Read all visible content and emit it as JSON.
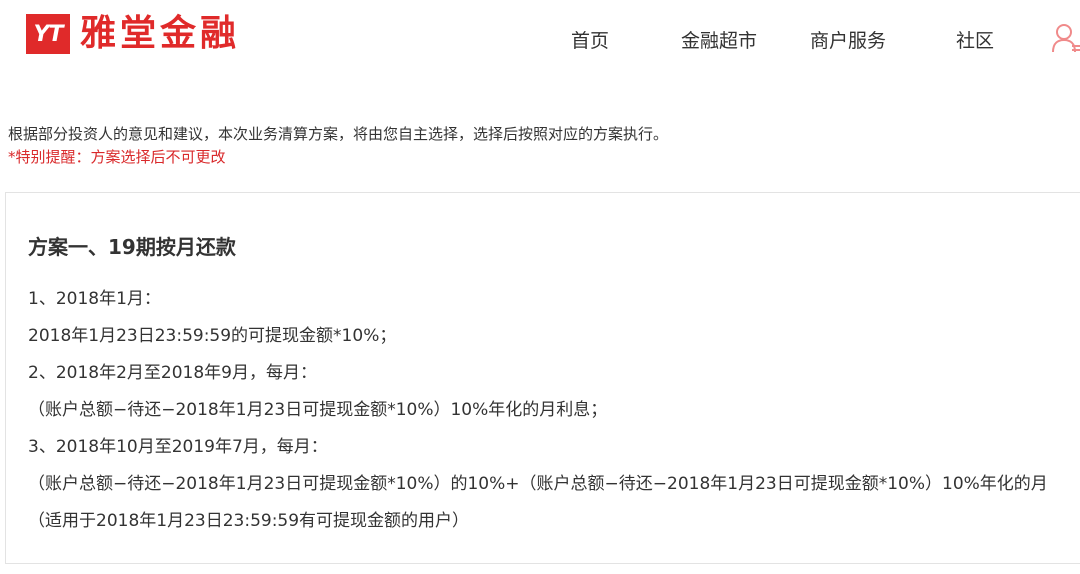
{
  "header": {
    "logo_mark": "YT",
    "logo_text": "雅堂金融",
    "nav": {
      "home": "首页",
      "market": "金融超市",
      "merchant": "商户服务",
      "community": "社区"
    },
    "user_icon": "user-icon"
  },
  "notice": {
    "text": "根据部分投资人的意见和建议，本次业务清算方案，将由您自主选择，选择后按照对应的方案执行。",
    "warning": "*特别提醒：方案选择后不可更改"
  },
  "plan": {
    "title": "方案一、19期按月还款",
    "lines": [
      "1、2018年1月：",
      "2018年1月23日23:59:59的可提现金额*10%；",
      "2、2018年2月至2018年9月，每月：",
      "（账户总额−待还−2018年1月23日可提现金额*10%）10%年化的月利息；",
      "3、2018年10月至2019年7月，每月：",
      "（账户总额−待还−2018年1月23日可提现金额*10%）的10%+（账户总额−待还−2018年1月23日可提现金额*10%）10%年化的月",
      "（适用于2018年1月23日23:59:59有可提现金额的用户）"
    ]
  },
  "colors": {
    "brand_red": "#e02a2a",
    "warning_red": "#d9292b",
    "text": "#333333",
    "border": "#e3e3e3"
  }
}
